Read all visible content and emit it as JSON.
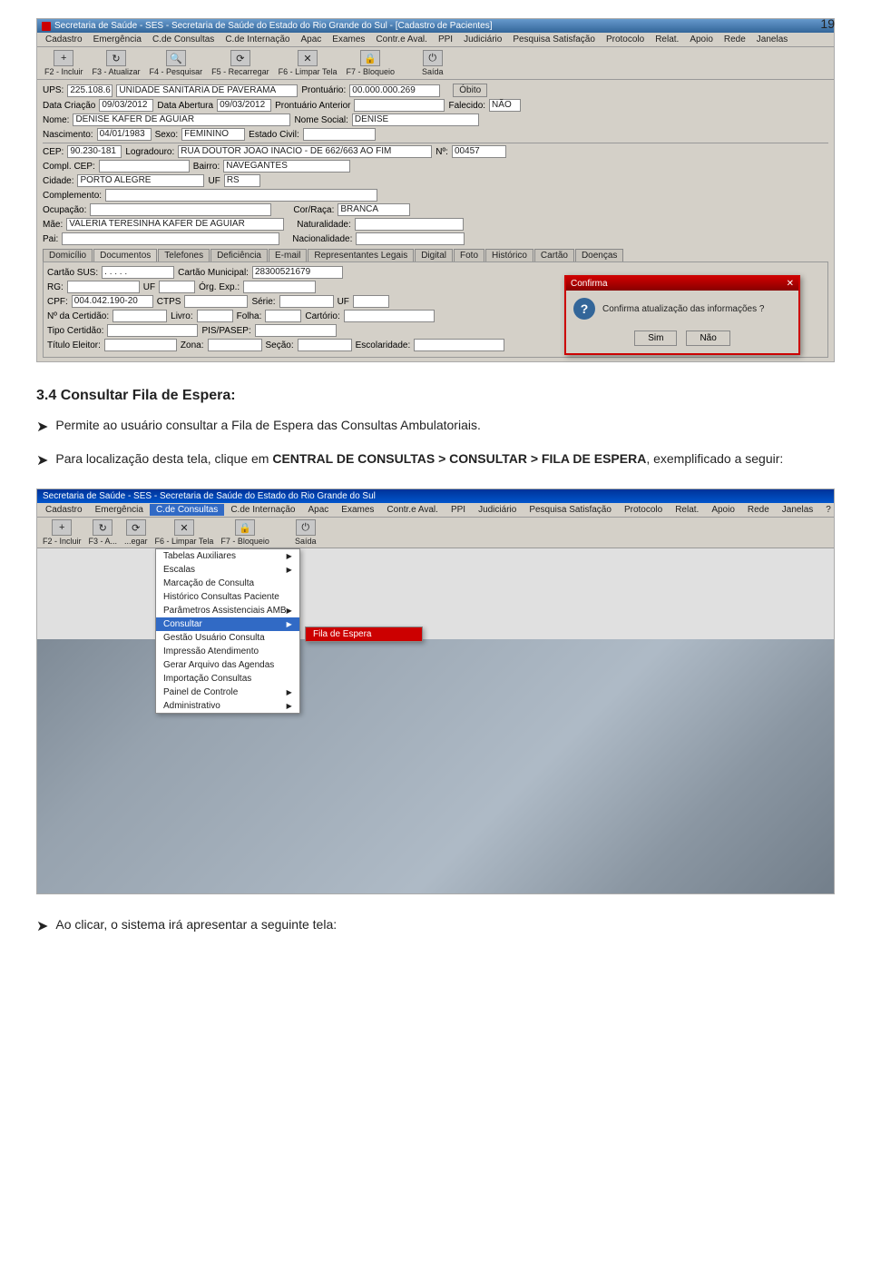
{
  "page": {
    "number": "19"
  },
  "top_screenshot": {
    "titlebar": "Secretaria de Saúde - SES - Secretaria de Saúde do Estado do Rio Grande do Sul - [Cadastro de Pacientes]",
    "menu_items": [
      "Cadastro",
      "Emergência",
      "C.de Consultas",
      "C.de Internação",
      "Apac",
      "Exames",
      "Contr.e Aval.",
      "PPI",
      "Judiciário",
      "Pesquisa Satisfação",
      "Protocolo",
      "Relat.",
      "Apoio",
      "Rede",
      "Janelas"
    ],
    "toolbar_buttons": [
      "F2 - Incluir",
      "F3 - Atualizar",
      "F4 - Pesquisar",
      "F5 - Recarregar",
      "F6 - Limpar Tela",
      "F7 - Bloqueio",
      "Saída"
    ],
    "form": {
      "ups_label": "UPS:",
      "ups_value": "225.108.6",
      "ups_name": "UNIDADE SANITARIA DE PAVERAMA",
      "prontuario_label": "Prontuário:",
      "prontuario_value": "00.000.000.269",
      "obito_label": "Óbito",
      "data_criacao_label": "Data Criação",
      "data_criacao_value": "09/03/2012",
      "data_abertura_label": "Data Abertura",
      "data_abertura_value": "09/03/2012",
      "prontuario_anterior_label": "Prontuário Anterior",
      "falecido_label": "Falecido:",
      "falecido_value": "NÃO",
      "nome_label": "Nome:",
      "nome_value": "DENISE KAFER DE AGUIAR",
      "nome_social_label": "Nome Social:",
      "nome_social_value": "DENISE",
      "nascimento_label": "Nascimento:",
      "nascimento_value": "04/01/1983",
      "sexo_label": "Sexo:",
      "sexo_value": "FEMININO",
      "estado_civil_label": "Estado Civil:",
      "cep_label": "CEP:",
      "cep_value": "90.230-181",
      "logradouro_label": "Logradouro:",
      "logradouro_value": "RUA DOUTOR JOAO INACIO - DE 662/663 AO FIM",
      "numero_label": "Nº:",
      "numero_value": "00457",
      "compl_cep_label": "Compl. CEP:",
      "bairro_label": "Bairro:",
      "bairro_value": "NAVEGANTES",
      "cidade_label": "Cidade:",
      "cidade_value": "PORTO ALEGRE",
      "uf_label": "UF",
      "uf_value": "RS",
      "complemento_label": "Complemento:",
      "ocupacao_label": "Ocupação:",
      "cor_raca_label": "Cor/Raça:",
      "cor_raca_value": "BRANCA",
      "mae_label": "Mãe:",
      "mae_value": "VALERIA TERESINHA KAFER DE AGUIAR",
      "naturalidade_label": "Naturalidade:",
      "pai_label": "Pai:",
      "nacionalidade_label": "Nacionalidade:"
    },
    "tabs": [
      "Domicílio",
      "Documentos",
      "Telefones",
      "Deficiência",
      "E-mail",
      "Representantes Legais",
      "Digital",
      "Foto",
      "Histórico",
      "Cartão",
      "Doenças"
    ],
    "docs_form": {
      "cartao_sus_label": "Cartão SUS:",
      "cartao_sus_value": ". . . . .",
      "cartao_municipal_label": "Cartão Municipal:",
      "cartao_municipal_value": "28300521679",
      "rg_label": "RG:",
      "uf_label": "UF",
      "org_exp_label": "Órg. Exp.:",
      "cpf_label": "CPF:",
      "cpf_value": "004.042.190-20",
      "ctps_label": "CTPS",
      "serie_label": "Série:",
      "uf2_label": "UF",
      "nro_certidao_label": "Nº da Certidão:",
      "livro_label": "Livro:",
      "folha_label": "Folha:",
      "cartorio_label": "Cartório:",
      "tipo_certidao_label": "Tipo Certidão:",
      "pis_pasep_label": "PIS/PASEP:",
      "titulo_eleitor_label": "Título Eleitor:",
      "zona_label": "Zona:",
      "secao_label": "Seção:",
      "escolaridade_label": "Escolaridade:"
    },
    "confirm_dialog": {
      "title": "Confirma",
      "icon_text": "?",
      "message": "Confirma atualização das informações ?",
      "btn_yes": "Sim",
      "btn_no": "Não"
    }
  },
  "section_3_4": {
    "heading": "3.4 Consultar Fila de Espera:",
    "bullet1": {
      "arrow": "➤",
      "text": "Permite ao usuário consultar a Fila de Espera das Consultas Ambulatoriais."
    },
    "bullet2": {
      "arrow": "➤",
      "text_prefix": "Para localização desta tela, clique em ",
      "path": "CENTRAL DE CONSULTAS > CONSULTAR > FILA DE ESPERA",
      "text_suffix": ", exemplificado a seguir:"
    }
  },
  "second_screenshot": {
    "titlebar": "Secretaria de Saúde - SES - Secretaria de Saúde do Estado do Rio Grande do Sul",
    "menu_items": [
      "Cadastro",
      "Emergência",
      "C.de Consultas",
      "C.de Internação",
      "Apac",
      "Exames",
      "Contr.e Aval.",
      "PPI",
      "Judiciário",
      "Pesquisa Satisfação",
      "Protocolo",
      "Relat.",
      "Apoio",
      "Rede",
      "Janelas",
      "?"
    ],
    "toolbar_buttons": [
      "F2 - Incluir",
      "F3 - A...",
      "...egar",
      "F6 - Limpar Tela",
      "F7 - Bloqueio",
      "Saída"
    ],
    "dropdown_cde": {
      "items": [
        "Tabelas Auxiliares",
        "Escalas",
        "Marcação de Consulta",
        "Histórico Consultas Paciente",
        "Parâmetros Assistenciais AMB",
        "Consultar",
        "Gestão Usuário Consulta",
        "Impressão Atendimento",
        "Gerar Arquivo das Agendas",
        "Importação Consultas",
        "Painel de Controle",
        "Administrativo"
      ]
    },
    "submenu_consultar": {
      "items": [
        "Fila de Espera"
      ]
    }
  },
  "last_section": {
    "arrow": "➤",
    "text": "Ao clicar, o sistema irá apresentar a seguinte tela:"
  }
}
